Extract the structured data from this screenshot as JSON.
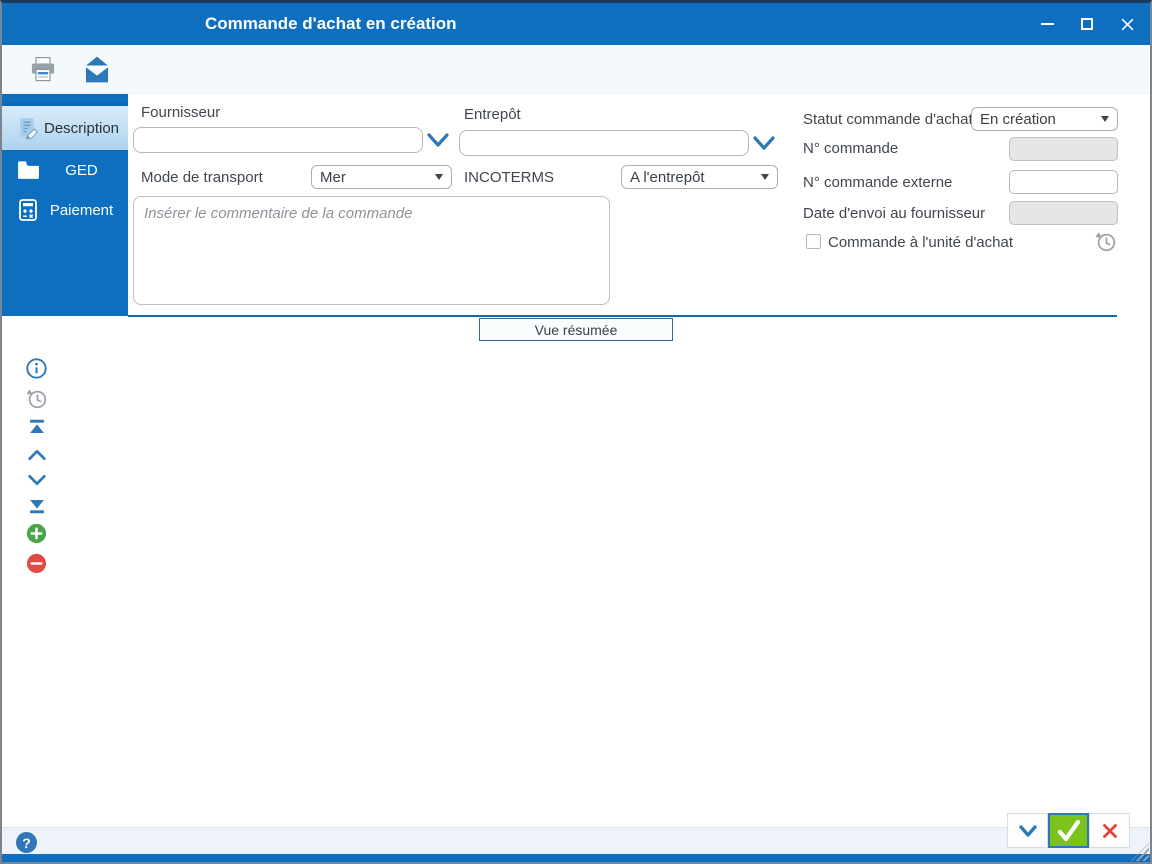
{
  "window": {
    "title": "Commande d'achat en création"
  },
  "sidebar": {
    "tabs": [
      {
        "label": "Description",
        "active": true
      },
      {
        "label": "GED",
        "active": false
      },
      {
        "label": "Paiement",
        "active": false
      }
    ]
  },
  "form": {
    "fournisseur_label": "Fournisseur",
    "fournisseur_value": "",
    "entrepot_label": "Entrepôt",
    "entrepot_value": "",
    "mode_transport_label": "Mode de transport",
    "mode_transport_value": "Mer",
    "incoterms_label": "INCOTERMS",
    "incoterms_value": "A l'entrepôt",
    "statut_label": "Statut commande d'achat",
    "statut_value": "En création",
    "num_commande_label": "N° commande",
    "num_commande_value": "",
    "num_commande_externe_label": "N° commande externe",
    "num_commande_externe_value": "",
    "date_envoi_label": "Date d'envoi au fournisseur",
    "date_envoi_value": "",
    "commande_unite_label": "Commande à l'unité d'achat",
    "commentaire_placeholder": "Insérer le commentaire de la commande",
    "commentaire_value": ""
  },
  "summary": {
    "button_label": "Vue résumée"
  },
  "footer": {
    "help_glyph": "?"
  },
  "colors": {
    "titlebar_blue": "#0e6fc1",
    "divider_blue": "#1468ad",
    "chevron_blue": "#2e78b8",
    "confirm_green": "#7cc41d",
    "cancel_red": "#e0433c",
    "add_green": "#4aa546",
    "remove_red": "#e04b44"
  }
}
